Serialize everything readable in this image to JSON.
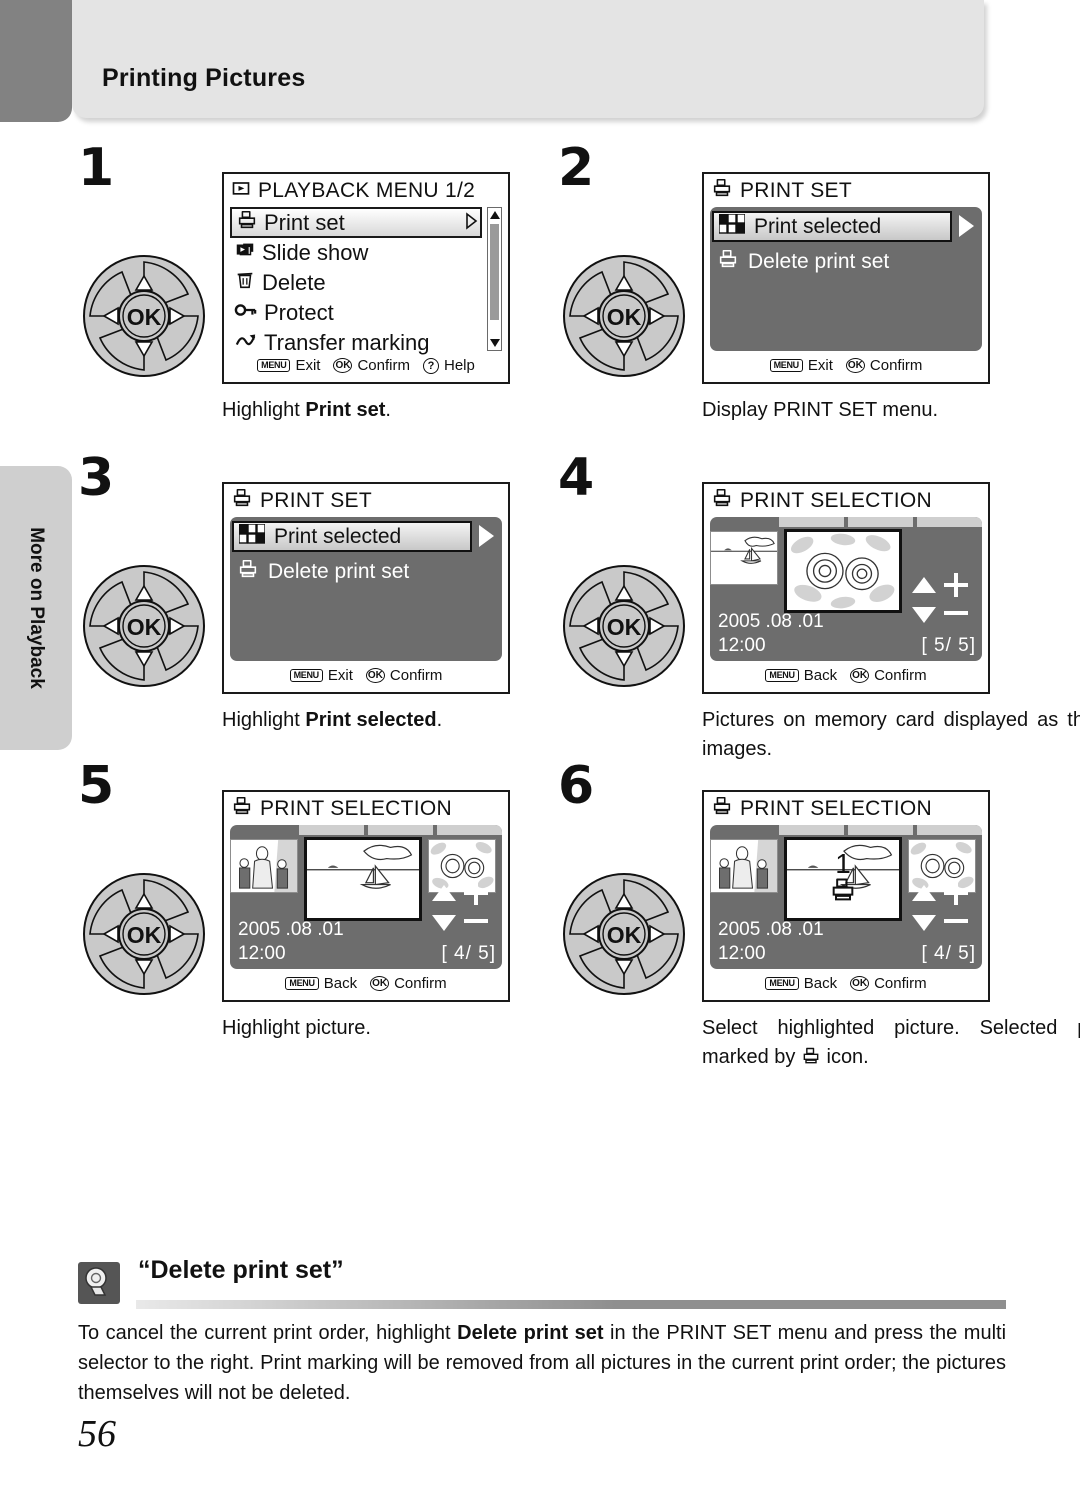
{
  "header": {
    "title": "Printing Pictures"
  },
  "side_tab": {
    "label": "More on Playback"
  },
  "page_number": "56",
  "steps": [
    {
      "number": "1",
      "screen": {
        "kind": "playback-menu",
        "title": "PLAYBACK MENU 1/2",
        "title_icon": "playback-icon",
        "items": [
          {
            "label": "Print set",
            "icon": "printer-icon",
            "selected": true
          },
          {
            "label": "Slide show",
            "icon": "slideshow-icon",
            "selected": false
          },
          {
            "label": "Delete",
            "icon": "trash-icon",
            "selected": false
          },
          {
            "label": "Protect",
            "icon": "key-icon",
            "selected": false
          },
          {
            "label": "Transfer marking",
            "icon": "transfer-icon",
            "selected": false
          }
        ],
        "footer": [
          {
            "key": "MENU",
            "label": "Exit"
          },
          {
            "key": "OK",
            "label": "Confirm"
          },
          {
            "key": "?",
            "label": "Help"
          }
        ]
      },
      "caption_before": "Highlight ",
      "caption_bold": "Print set",
      "caption_after": "."
    },
    {
      "number": "2",
      "screen": {
        "kind": "print-set",
        "title": "PRINT SET",
        "title_icon": "printer-icon",
        "items": [
          {
            "label": "Print selected",
            "icon": "grid-icon",
            "selected": true
          },
          {
            "label": "Delete print set",
            "icon": "printer-icon",
            "selected": false
          }
        ],
        "footer": [
          {
            "key": "MENU",
            "label": "Exit"
          },
          {
            "key": "OK",
            "label": "Confirm"
          }
        ]
      },
      "caption_before": "Display PRINT SET menu.",
      "caption_bold": "",
      "caption_after": ""
    },
    {
      "number": "3",
      "screen": {
        "kind": "print-set",
        "title": "PRINT SET",
        "title_icon": "printer-icon",
        "items": [
          {
            "label": "Print selected",
            "icon": "grid-icon",
            "selected": true
          },
          {
            "label": "Delete print set",
            "icon": "printer-icon",
            "selected": false
          }
        ],
        "footer": [
          {
            "key": "MENU",
            "label": "Exit"
          },
          {
            "key": "OK",
            "label": "Confirm"
          }
        ]
      },
      "caption_before": "Highlight ",
      "caption_bold": "Print selected",
      "caption_after": "."
    },
    {
      "number": "4",
      "screen": {
        "kind": "print-selection",
        "title": "PRINT SELECTION",
        "title_icon": "printer-icon",
        "date": "2005 .08 .01",
        "time": "12:00",
        "counter": "[   5/    5]",
        "thumb_left": "beach-thumbnail",
        "thumb_main": "flowers-thumbnail",
        "thumb_right": "",
        "marked": false,
        "mark_count": "",
        "plus_minus": {
          "plus": "+",
          "minus": "−"
        },
        "footer": [
          {
            "key": "MENU",
            "label": "Back"
          },
          {
            "key": "OK",
            "label": "Confirm"
          }
        ]
      },
      "caption_before": "Pictures on memory card displayed as thumbnail images.",
      "caption_bold": "",
      "caption_after": ""
    },
    {
      "number": "5",
      "screen": {
        "kind": "print-selection",
        "title": "PRINT SELECTION",
        "title_icon": "printer-icon",
        "date": "2005 .08 .01",
        "time": "12:00",
        "counter": "[   4/    5]",
        "thumb_left": "family-thumbnail",
        "thumb_main": "beach-thumbnail",
        "thumb_right": "flowers-thumbnail",
        "marked": false,
        "mark_count": "",
        "plus_minus": {
          "plus": "+",
          "minus": "−"
        },
        "footer": [
          {
            "key": "MENU",
            "label": "Back"
          },
          {
            "key": "OK",
            "label": "Confirm"
          }
        ]
      },
      "caption_before": "Highlight picture.",
      "caption_bold": "",
      "caption_after": ""
    },
    {
      "number": "6",
      "screen": {
        "kind": "print-selection",
        "title": "PRINT SELECTION",
        "title_icon": "printer-icon",
        "date": "2005 .08 .01",
        "time": "12:00",
        "counter": "[   4/    5]",
        "thumb_left": "family-thumbnail",
        "thumb_main": "beach-thumbnail",
        "thumb_right": "flowers-thumbnail",
        "marked": true,
        "mark_count": "1",
        "plus_minus": {
          "plus": "+",
          "minus": "−"
        },
        "footer": [
          {
            "key": "MENU",
            "label": "Back"
          },
          {
            "key": "OK",
            "label": "Confirm"
          }
        ]
      },
      "caption_before": "Select highlighted picture. Selected pictures marked by ",
      "caption_bold": "",
      "caption_after": " icon."
    }
  ],
  "captions": {
    "step1": {
      "pre": "Highlight ",
      "bold": "Print set",
      "post": "."
    },
    "step2": {
      "pre": "Display PRINT SET menu.",
      "bold": "",
      "post": ""
    },
    "step3": {
      "pre": "Highlight ",
      "bold": "Print selected",
      "post": "."
    },
    "step4": {
      "pre": "Pictures on memory card displayed as thumbnail images.",
      "bold": "",
      "post": ""
    },
    "step5": {
      "pre": "Highlight picture.",
      "bold": "",
      "post": ""
    },
    "step6": {
      "pre": "Select highlighted picture. Selected pic-tures marked by ",
      "bold": "",
      "post": " icon."
    }
  },
  "note": {
    "icon": "tip-bulb-icon",
    "title": "“Delete print set”",
    "body_pre": "To cancel the current print order, highlight ",
    "body_bold": "Delete print set",
    "body_post": " in the PRINT SET menu and press the multi selector to the right. Print marking will be removed from all pictures in the current print order; the pictures themselves will not be deleted."
  },
  "dial": {
    "name": "multi-selector",
    "center_label": "OK"
  }
}
